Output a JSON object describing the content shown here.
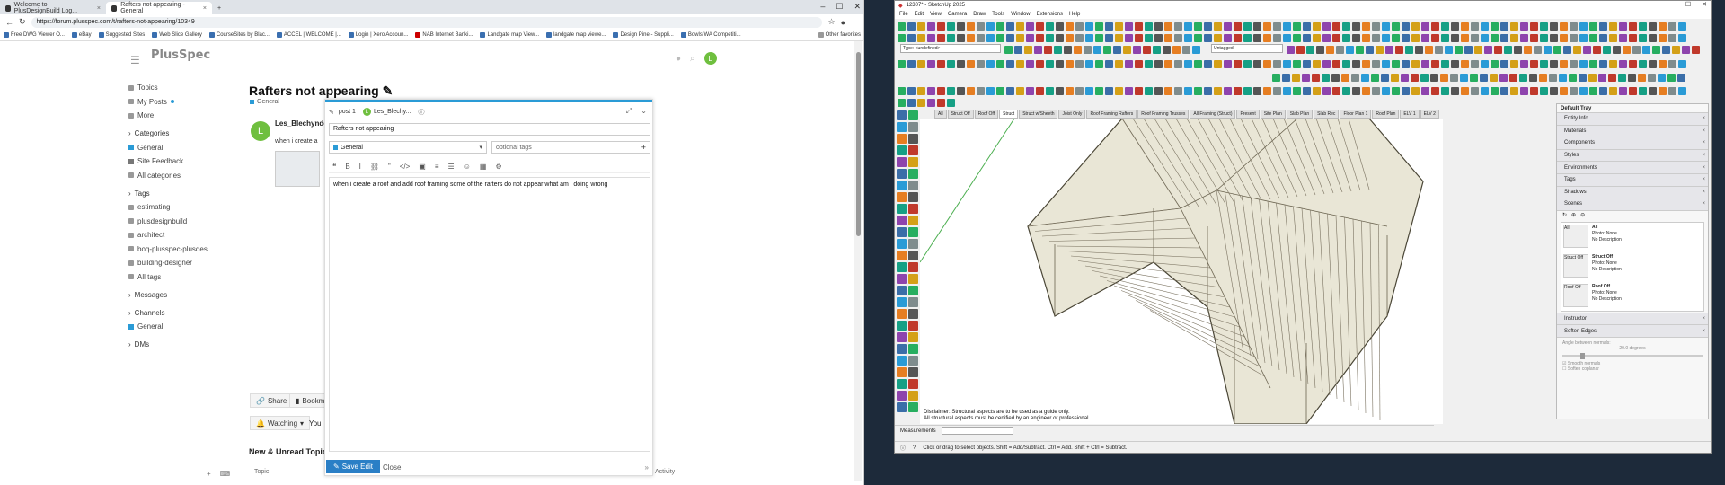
{
  "browser": {
    "tabs": [
      {
        "label": "Welcome to PlusDesignBuild Log...",
        "active": false
      },
      {
        "label": "Rafters not appearing - General",
        "active": true
      }
    ],
    "new_tab": "+",
    "url": "https://forum.plusspec.com/t/rafters-not-appearing/10349",
    "bookmarks": [
      "Free DWG Viewer O...",
      "eBay",
      "Suggested Sites",
      "Web Slice Gallery",
      "CourseSites by Blac...",
      "ACCEL | WELCOME |...",
      "Login | Xero Accoun...",
      "NAB Internet Banki...",
      "Landgate map View...",
      "landgate map viewe...",
      "Design Pine - Suppli...",
      "Bowls WA Competiti..."
    ],
    "other_favorites": "Other favorites"
  },
  "site": {
    "logo": "PlusSpec",
    "avatar_letter": "L",
    "sidebar": {
      "top": [
        "Topics",
        "My Posts",
        "More"
      ],
      "categories_head": "Categories",
      "categories": [
        "General",
        "Site Feedback",
        "All categories"
      ],
      "tags_head": "Tags",
      "tags": [
        "estimating",
        "plusdesignbuild",
        "architect",
        "boq-plusspec-plusdes",
        "building-designer",
        "All tags"
      ],
      "messages_head": "Messages",
      "channels_head": "Channels",
      "channels": [
        "General"
      ],
      "dms_head": "DMs"
    },
    "topic": {
      "title": "Rafters not appearing",
      "category": "General",
      "user": "Les_Blechynde",
      "body": "when i create a",
      "share": "Share",
      "bookmark": "Bookm",
      "watching": "Watching",
      "you": "You",
      "new_unread": "New & Unread Topic",
      "col_topic": "Topic",
      "col_activity": "Activity"
    },
    "composer": {
      "post_label": "post 1",
      "user": "Les_Blechy...",
      "title_value": "Rafters not appearing",
      "category": "General",
      "tags_placeholder": "optional tags",
      "body": "when i create a roof and add roof framing some of the rafters do not appear what am i doing wrong",
      "save": "Save Edit",
      "close": "Close"
    }
  },
  "sketchup": {
    "title": "12307* - SketchUp 2025",
    "menu": [
      "File",
      "Edit",
      "View",
      "Camera",
      "Draw",
      "Tools",
      "Window",
      "Extensions",
      "Help"
    ],
    "type_select": "Type: <undefined>",
    "tag_select": "Untagged",
    "scene_tabs": [
      "All",
      "Struct Off",
      "Roof Off",
      "Struct",
      "Struct w/Sheeth",
      "Joist Only",
      "Roof Framing Rafters",
      "Roof Framing Trusses",
      "All Framing (Struct)",
      "Present",
      "Site Plan",
      "Slab Plan",
      "Slab Rec",
      "Floor Plan 1",
      "Roof Plan",
      "ELV 1",
      "ELV 2"
    ],
    "active_scene": "Struct",
    "disclaimer_1": "Disclaimer: Structural aspects are to be used as a guide only.",
    "disclaimer_2": "All structural aspects must be certified by an engineer or professional.",
    "measurements_label": "Measurements",
    "status_text": "Click or drag to select objects. Shift = Add/Subtract. Ctrl = Add. Shift + Ctrl = Subtract.",
    "tray": {
      "title": "Default Tray",
      "sections": [
        "Entity Info",
        "Materials",
        "Components",
        "Styles",
        "Environments",
        "Tags",
        "Shadows",
        "Scenes"
      ],
      "scenes": [
        {
          "name": "All",
          "photo": "Photo: None",
          "desc": "No Description"
        },
        {
          "name": "Struct Off",
          "photo": "Photo: None",
          "desc": "No Description"
        },
        {
          "name": "Roof Off",
          "photo": "Photo: None",
          "desc": "No Description"
        }
      ],
      "lower_sections": [
        "Instructor",
        "Soften Edges"
      ],
      "angle_label": "Angle between normals:",
      "angle_value": "20.0  degrees",
      "smooth": "Smooth normals",
      "soften": "Soften coplanar"
    }
  }
}
